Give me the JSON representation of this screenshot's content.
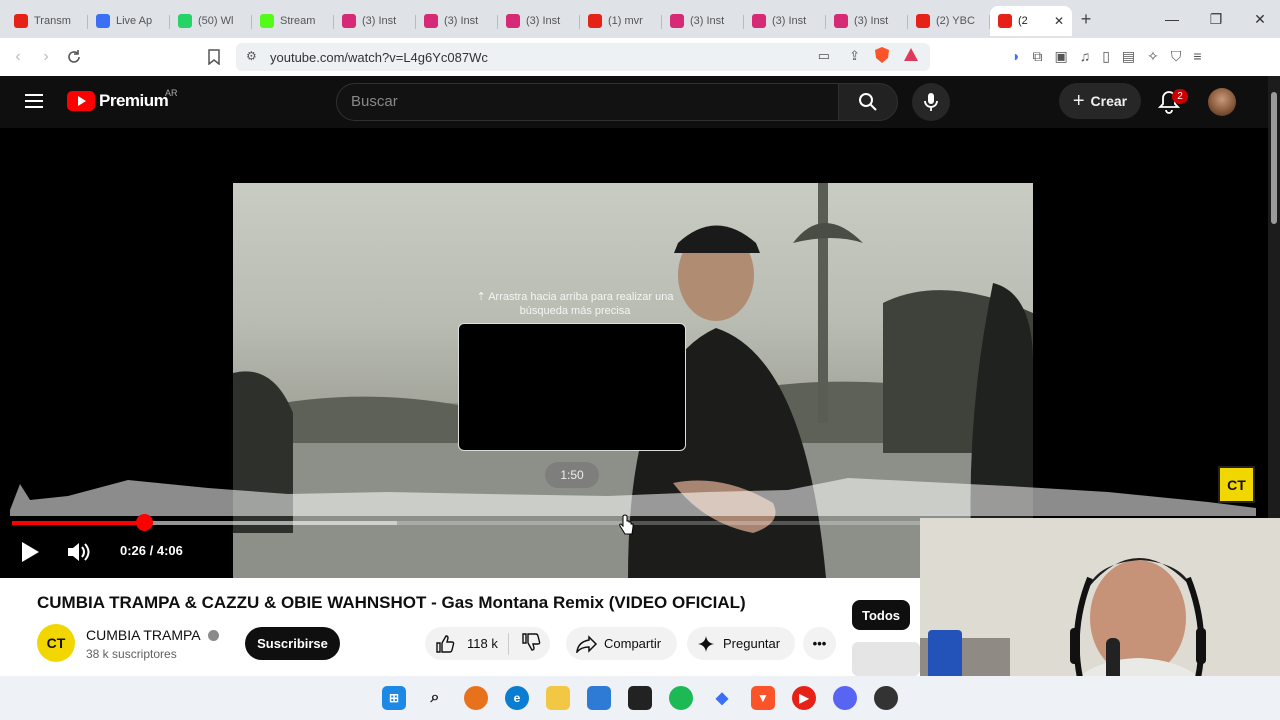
{
  "browser": {
    "tabs": [
      {
        "label": "Transm",
        "color": "#e62117"
      },
      {
        "label": "Live Ap",
        "color": "#3b6ff5"
      },
      {
        "label": "(50) Wl",
        "color": "#25d366"
      },
      {
        "label": "Stream",
        "color": "#53fc18"
      },
      {
        "label": "(3) Inst",
        "color": "#d62976"
      },
      {
        "label": "(3) Inst",
        "color": "#d62976"
      },
      {
        "label": "(3) Inst",
        "color": "#d62976"
      },
      {
        "label": "(1) mvr",
        "color": "#e62117"
      },
      {
        "label": "(3) Inst",
        "color": "#d62976"
      },
      {
        "label": "(3) Inst",
        "color": "#d62976"
      },
      {
        "label": "(3) Inst",
        "color": "#d62976"
      },
      {
        "label": "(2) YBC",
        "color": "#e62117"
      },
      {
        "label": "(2",
        "color": "#e62117"
      }
    ],
    "url": "youtube.com/watch?v=L4g6Yc087Wc"
  },
  "youtube": {
    "logo_text": "Premium",
    "region": "AR",
    "search_placeholder": "Buscar",
    "create_label": "Crear",
    "notifications": "2"
  },
  "player": {
    "hint": "⇡ Arrastra hacia arriba para realizar una búsqueda más precisa",
    "hover_time": "1:50",
    "time": "0:26 / 4:06",
    "progress": 0.106,
    "buffered": 0.31,
    "watermark": "CT"
  },
  "video": {
    "title": "CUMBIA TRAMPA & CAZZU & OBIE WAHNSHOT - Gas Montana Remix (VIDEO OFICIAL)",
    "channel": "CUMBIA TRAMPA",
    "channel_initials": "CT",
    "subscribers": "38 k suscriptores",
    "subscribe_label": "Suscribirse",
    "likes": "118 k",
    "share_label": "Compartir",
    "ask_label": "Preguntar"
  },
  "side": {
    "chip_all": "Todos"
  }
}
